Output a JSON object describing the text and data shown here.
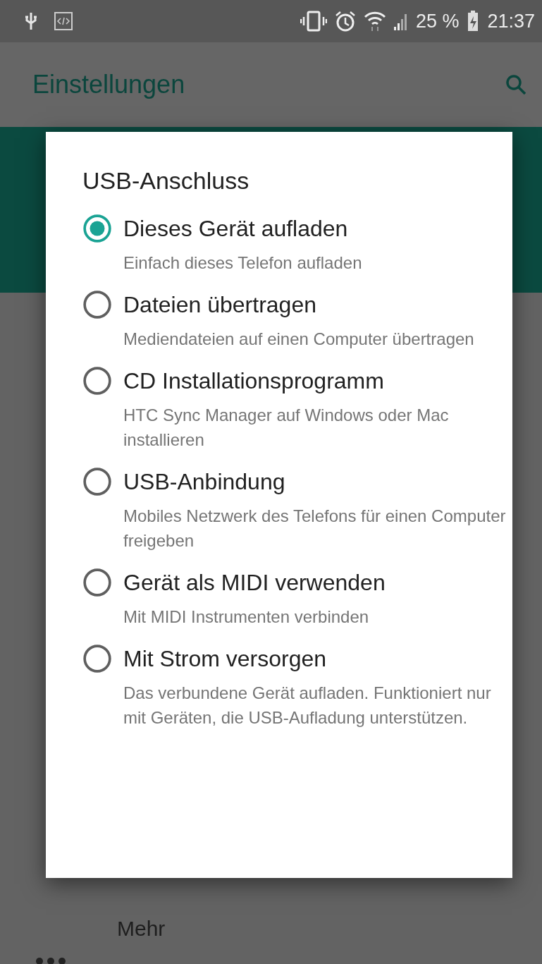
{
  "status_bar": {
    "battery": "25 %",
    "time": "21:37"
  },
  "toolbar": {
    "title": "Einstellungen"
  },
  "dialog": {
    "title": "USB-Anschluss",
    "options": [
      {
        "label": "Dieses Gerät aufladen",
        "description": "Einfach dieses Telefon aufladen",
        "selected": true
      },
      {
        "label": "Dateien übertragen",
        "description": "Mediendateien auf einen Computer übertragen",
        "selected": false
      },
      {
        "label": "CD Installationsprogramm",
        "description": "HTC Sync Manager auf Windows oder Mac installieren",
        "selected": false
      },
      {
        "label": "USB-Anbindung",
        "description": "Mobiles Netzwerk des Telefons für einen Computer freigeben",
        "selected": false
      },
      {
        "label": "Gerät als MIDI verwenden",
        "description": "Mit MIDI Instrumenten verbinden",
        "selected": false
      },
      {
        "label": "Mit Strom versorgen",
        "description": "Das verbundene Gerät aufladen. Funktioniert nur mit Geräten, die USB-Aufladung unterstützen.",
        "selected": false
      }
    ]
  },
  "background_list": [
    {
      "label": "Mehr"
    }
  ]
}
